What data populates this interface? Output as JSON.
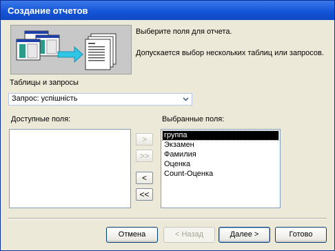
{
  "window": {
    "title": "Создание отчетов"
  },
  "intro": {
    "line1": "Выберите поля для отчета.",
    "line2": "Допускается выбор нескольких таблиц или запросов."
  },
  "tables": {
    "label": "Таблицы и запросы",
    "selected": "Запрос: успішність"
  },
  "available": {
    "label": "Доступные поля:",
    "items": []
  },
  "selected_fields": {
    "label": "Выбранные поля:",
    "items": [
      "группа",
      "Экзамен",
      "Фамилия",
      "Оценка",
      "Count-Оценка"
    ],
    "highlighted_index": 0
  },
  "move_buttons": {
    "add_one": ">",
    "add_all": ">>",
    "remove_one": "<",
    "remove_all": "<<"
  },
  "buttons": {
    "cancel": "Отмена",
    "back": "< Назад",
    "next": "Далее >",
    "finish": "Готово"
  },
  "colors": {
    "title_bar": "#1556d8",
    "dialog_bg": "#ece9d8",
    "selection_bg": "#000000"
  }
}
